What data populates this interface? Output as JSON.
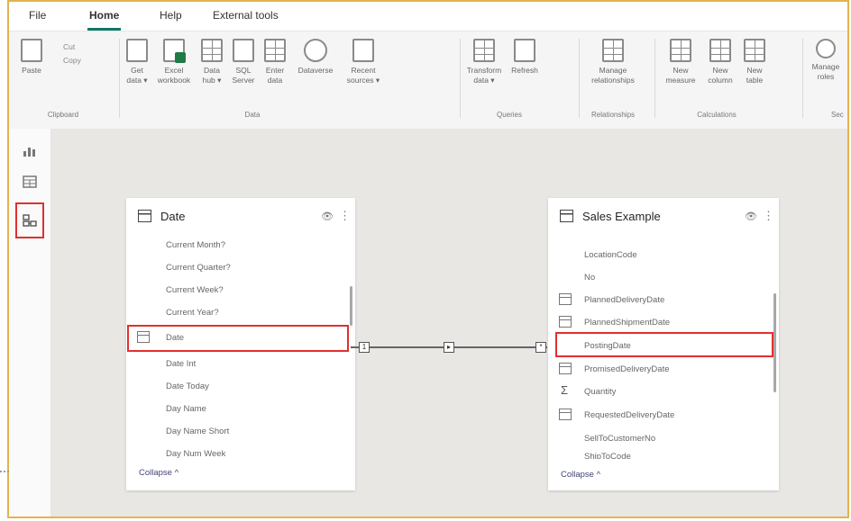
{
  "menu": [
    "File",
    "Home",
    "Help",
    "External tools"
  ],
  "ribbon": {
    "clipboard": {
      "paste": "Paste",
      "cut": "Cut",
      "copy": "Copy",
      "group": "Clipboard"
    },
    "data": {
      "group": "Data",
      "buttons": [
        {
          "line1": "Get",
          "line2": "data ▾"
        },
        {
          "line1": "Excel",
          "line2": "workbook"
        },
        {
          "line1": "Data",
          "line2": "hub ▾"
        },
        {
          "line1": "SQL",
          "line2": "Server"
        },
        {
          "line1": "Enter",
          "line2": "data"
        },
        {
          "line1": "Dataverse",
          "line2": ""
        },
        {
          "line1": "Recent",
          "line2": "sources ▾"
        }
      ]
    },
    "queries": {
      "group": "Queries",
      "buttons": [
        {
          "line1": "Transform",
          "line2": "data ▾"
        },
        {
          "line1": "Refresh",
          "line2": ""
        }
      ]
    },
    "relationships": {
      "group": "Relationships",
      "buttons": [
        {
          "line1": "Manage",
          "line2": "relationships"
        }
      ]
    },
    "calculations": {
      "group": "Calculations",
      "buttons": [
        {
          "line1": "New",
          "line2": "measure"
        },
        {
          "line1": "New",
          "line2": "column"
        },
        {
          "line1": "New",
          "line2": "table"
        }
      ]
    },
    "security": {
      "group": "Sec",
      "buttons": [
        {
          "line1": "Manage",
          "line2": "roles"
        }
      ]
    }
  },
  "date_table": {
    "title": "Date",
    "fields": [
      "Current Month?",
      "Current Quarter?",
      "Current Week?",
      "Current Year?",
      "Date",
      "Date Int",
      "Date Today",
      "Day Name",
      "Day Name Short",
      "Day Num Week"
    ],
    "collapse": "Collapse ^"
  },
  "sales_table": {
    "title": "Sales Example",
    "fields": [
      "LocationCode",
      "No",
      "PlannedDeliveryDate",
      "PlannedShipmentDate",
      "PostingDate",
      "PromisedDeliveryDate",
      "Quantity",
      "RequestedDeliveryDate",
      "SellToCustomerNo",
      "ShipToCode"
    ],
    "collapse": "Collapse ^"
  },
  "relationship": {
    "from_card": "1",
    "direction": "▸",
    "to_card": "*"
  }
}
